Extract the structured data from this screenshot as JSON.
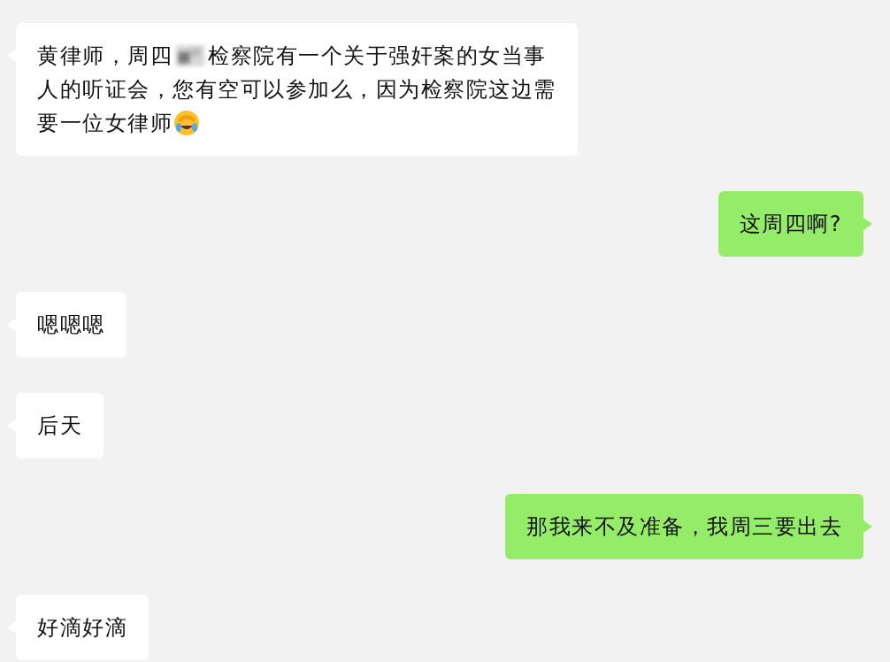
{
  "messages": [
    {
      "kind": "incoming",
      "lines": [
        [
          {
            "kind": "text",
            "text": "黄律师，周四"
          },
          {
            "kind": "redaction"
          },
          {
            "kind": "text",
            "text": "检察院有一个关于强奸案的女当事"
          }
        ],
        [
          {
            "kind": "text",
            "text": "人的听证会，您有空可以参加么，因为检察院这边需"
          }
        ],
        [
          {
            "kind": "text",
            "text": "要一位女律师"
          },
          {
            "kind": "emoji"
          }
        ]
      ]
    },
    {
      "kind": "outgoing",
      "lines": [
        [
          {
            "kind": "text",
            "text": "这周四啊?"
          }
        ]
      ]
    },
    {
      "kind": "incoming",
      "lines": [
        [
          {
            "kind": "text",
            "text": "嗯嗯嗯"
          }
        ]
      ]
    },
    {
      "kind": "incoming",
      "lines": [
        [
          {
            "kind": "text",
            "text": "后天"
          }
        ]
      ]
    },
    {
      "kind": "outgoing",
      "lines": [
        [
          {
            "kind": "text",
            "text": "那我来不及准备，我周三要出去"
          }
        ]
      ]
    },
    {
      "kind": "incoming",
      "lines": [
        [
          {
            "kind": "text",
            "text": "好滴好滴"
          }
        ]
      ]
    }
  ]
}
